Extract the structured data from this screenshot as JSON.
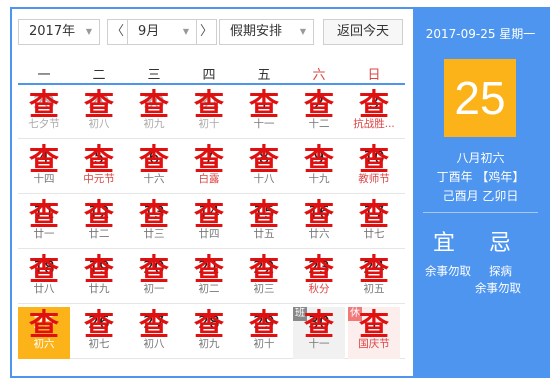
{
  "toolbar": {
    "year": "2017年",
    "month": "9月",
    "prev_month": "〈",
    "next_month": "〉",
    "holiday": "假期安排",
    "today_button": "返回今天",
    "dropdown_glyph": "▼"
  },
  "weekdays": [
    "一",
    "二",
    "三",
    "四",
    "五",
    "六",
    "日"
  ],
  "overlay_glyph": "查",
  "weeks": [
    [
      {
        "day": "28",
        "lunar": "七夕节",
        "state": "other"
      },
      {
        "day": "29",
        "lunar": "初八",
        "state": "other"
      },
      {
        "day": "30",
        "lunar": "初九",
        "state": "other"
      },
      {
        "day": "31",
        "lunar": "初十",
        "state": "other"
      },
      {
        "day": "1",
        "lunar": "十一"
      },
      {
        "day": "2",
        "lunar": "十二"
      },
      {
        "day": "3",
        "lunar": "抗战胜...",
        "highlight": true
      }
    ],
    [
      {
        "day": "4",
        "lunar": "十四"
      },
      {
        "day": "5",
        "lunar": "中元节",
        "highlight": true
      },
      {
        "day": "6",
        "lunar": "十六"
      },
      {
        "day": "7",
        "lunar": "白露",
        "highlight": true
      },
      {
        "day": "8",
        "lunar": "十八"
      },
      {
        "day": "9",
        "lunar": "十九"
      },
      {
        "day": "10",
        "lunar": "教师节",
        "highlight": true
      }
    ],
    [
      {
        "day": "11",
        "lunar": "廿一"
      },
      {
        "day": "12",
        "lunar": "廿二"
      },
      {
        "day": "13",
        "lunar": "廿三"
      },
      {
        "day": "14",
        "lunar": "廿四"
      },
      {
        "day": "15",
        "lunar": "廿五"
      },
      {
        "day": "16",
        "lunar": "廿六"
      },
      {
        "day": "17",
        "lunar": "廿七"
      }
    ],
    [
      {
        "day": "18",
        "lunar": "廿八"
      },
      {
        "day": "19",
        "lunar": "廿九"
      },
      {
        "day": "20",
        "lunar": "初一"
      },
      {
        "day": "21",
        "lunar": "初二"
      },
      {
        "day": "22",
        "lunar": "初三"
      },
      {
        "day": "23",
        "lunar": "秋分",
        "highlight": true
      },
      {
        "day": "24",
        "lunar": "初五"
      }
    ],
    [
      {
        "day": "25",
        "lunar": "初六",
        "state": "today"
      },
      {
        "day": "26",
        "lunar": "初七"
      },
      {
        "day": "27",
        "lunar": "初八"
      },
      {
        "day": "28",
        "lunar": "初九"
      },
      {
        "day": "29",
        "lunar": "初十"
      },
      {
        "day": "30",
        "lunar": "十一",
        "state": "work",
        "tag": "班"
      },
      {
        "day": "1",
        "lunar": "国庆节",
        "state": "off",
        "tag": "休",
        "highlight": true
      }
    ]
  ],
  "side": {
    "date_line": "2017-09-25 星期一",
    "big_day": "25",
    "lunar_date": "八月初六",
    "ganzhi_year": "丁酉年 【鸡年】",
    "ganzhi_month": "己酉月 乙卯日",
    "yi_title": "宜",
    "ji_title": "忌",
    "yi_text": "余事勿取",
    "ji_text_1": "探病",
    "ji_text_2": "余事勿取"
  },
  "colors": {
    "accent": "#4e95f0",
    "today": "#fcb31a",
    "holiday_red": "#d44444",
    "overlay_red": "#e01010"
  }
}
